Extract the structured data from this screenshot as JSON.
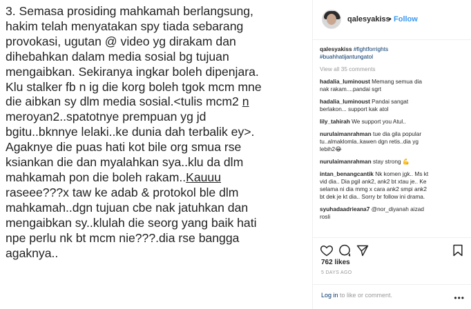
{
  "post": {
    "lines": [
      "3. Semasa prosiding mahkamah berlangsung,",
      "hakim telah menyatakan spy tiada sebarang",
      "provokasi, ugutan @ video yg dirakam dan",
      "dihebahkan dalam media sosial bg tujuan",
      "mengaibkan. Sekiranya ingkar boleh dipenjara.",
      "Klu stalker fb n ig die korg boleh tgok mcm mne",
      "die aibkan sy dlm media sosial.<tulis mcm2 ",
      "meroyan2..spatotnye prempuan yg jd",
      "bgitu..bknnye lelaki..ke dunia dah terbalik ey>.",
      "Agaknye die puas hati kot bile org smua rse",
      "ksiankan die dan myalahkan sya..klu da dlm",
      "mahkamah pon die boleh rakam..",
      "raseee???x taw ke adab & protokol ble dlm",
      "mahkamah..dgn tujuan cbe nak jatuhkan dan",
      "mengaibkan sy..klulah die seorg yang baik hati",
      "npe perlu nk bt mcm nie???.dia rse bangga",
      "agaknya.."
    ],
    "underlined_n": "n",
    "underlined_kauuu": "Kauuu"
  },
  "header": {
    "username": "qalesyakiss",
    "separator": "•",
    "follow_label": "Follow"
  },
  "caption": {
    "username": "qalesyakiss",
    "hashtag1": "#fightforrights",
    "hashtag2": "#buahhatijantungatol"
  },
  "view_all_label": "View all 35 comments",
  "comments": [
    {
      "user": "hadalia_luminoust",
      "lines": [
        " Memang semua dia",
        "nak rakam....pandai sgrt"
      ]
    },
    {
      "user": "hadalia_luminoust",
      "lines": [
        " Pandai sangat",
        "berlakon... support kak atol"
      ]
    },
    {
      "user": "lily_tahirah",
      "lines": [
        " We support you Atul.."
      ]
    },
    {
      "user": "nurulaimanrahman",
      "lines": [
        " tue dia gila popular",
        "tu..almaklomla..kawen dgn retis..dia yg",
        "lebih2😂"
      ]
    },
    {
      "user": "nurulaimanrahman",
      "lines": [
        " stay strong 💪"
      ]
    },
    {
      "user": "intan_benangcantik",
      "lines": [
        " Nk komen jgk.. Ms kt",
        "vid dia.. Dia pgil ank2, ank2 bt xtau je.. Ke",
        "selama ni dia mmg x cara ank2 smpi ank2",
        "bt dek je kt dia.. Sorry br follow ini drama."
      ]
    },
    {
      "user": "syuhadaadrieana7",
      "lines": [
        " @nor_diyanah aizad",
        "rosli"
      ]
    }
  ],
  "likes_label": "762 likes",
  "timestamp": "5 DAYS AGO",
  "login": {
    "link": "Log in",
    "rest": " to like or comment."
  },
  "colors": {
    "link_blue": "#3897f0",
    "hashtag_navy": "#003569",
    "muted_gray": "#999999",
    "text": "#262626"
  },
  "icons": [
    "heart-icon",
    "comment-icon",
    "share-icon",
    "bookmark-icon",
    "more-options-icon"
  ]
}
